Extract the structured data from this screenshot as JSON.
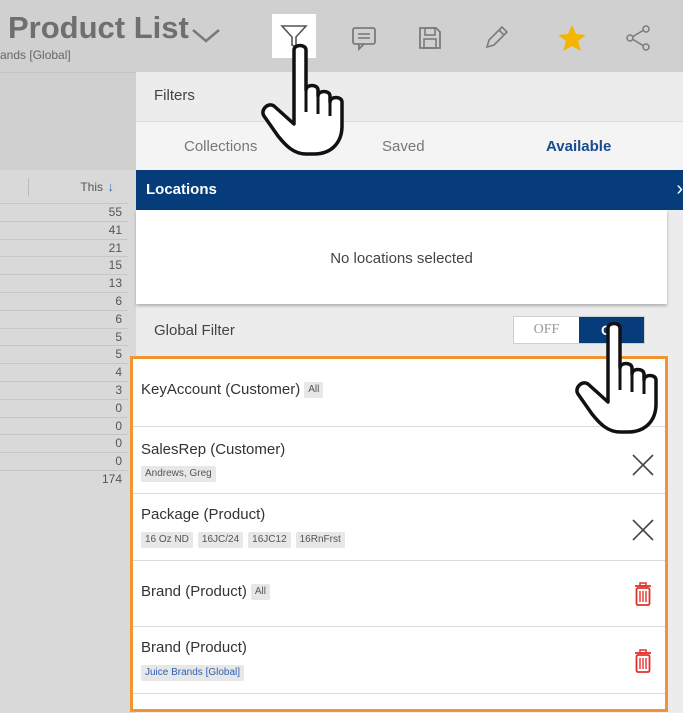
{
  "header": {
    "title": "Product List",
    "subtitle": "ands [Global]",
    "icons": [
      "filter-icon",
      "comment-icon",
      "save-icon",
      "edit-icon",
      "star-icon",
      "share-icon"
    ],
    "star_color": "#f5b400"
  },
  "left_column": {
    "header_label": "This",
    "values": [
      "55",
      "41",
      "21",
      "15",
      "13",
      "6",
      "6",
      "5",
      "5",
      "4",
      "3",
      "0",
      "0",
      "0",
      "0",
      "174"
    ]
  },
  "filters_panel": {
    "title": "Filters",
    "tabs": [
      {
        "label": "Collections",
        "active": false
      },
      {
        "label": "Saved",
        "active": false
      },
      {
        "label": "Available",
        "active": true
      }
    ],
    "locations": {
      "title": "Locations",
      "empty_text": "No locations selected"
    },
    "global_filter": {
      "label": "Global Filter",
      "off_label": "OFF",
      "on_label": "ON",
      "state": "on"
    },
    "filters": [
      {
        "name": "KeyAccount (Customer)",
        "inline_tag": "All",
        "tags": [],
        "action": "none"
      },
      {
        "name": "SalesRep (Customer)",
        "inline_tag": "",
        "tags": [
          "Andrews, Greg"
        ],
        "action": "remove"
      },
      {
        "name": "Package (Product)",
        "inline_tag": "",
        "tags": [
          "16 Oz ND",
          "16JC/24",
          "16JC12",
          "16RnFrst"
        ],
        "action": "remove"
      },
      {
        "name": "Brand (Product)",
        "inline_tag": "All",
        "tags": [],
        "action": "delete"
      },
      {
        "name": "Brand (Product)",
        "inline_tag": "",
        "tags": [
          "Juice Brands [Global]"
        ],
        "action": "delete"
      }
    ]
  },
  "colors": {
    "accent": "#073c7a",
    "highlight_border": "#f19532",
    "delete": "#e2312b",
    "link_tag": "#2d62b0"
  }
}
